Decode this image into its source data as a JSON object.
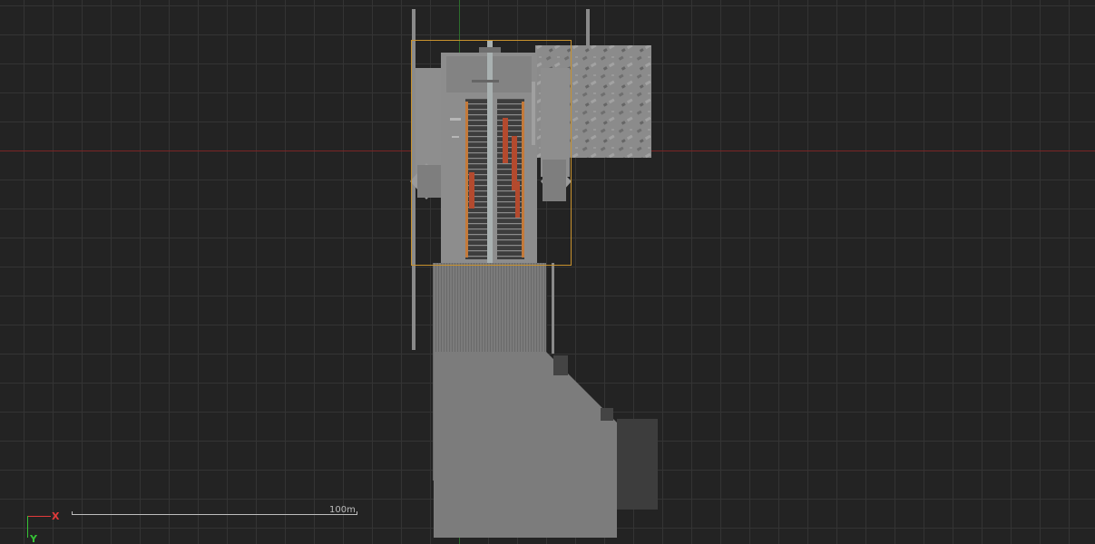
{
  "viewport": {
    "view": "top",
    "grid": true,
    "background_color": "#232323",
    "grid_color": "#343434"
  },
  "axes": {
    "x_label": "X",
    "y_label": "Y",
    "x_color": "#e23a3a",
    "y_color": "#36c236"
  },
  "scale_bar": {
    "label": "100m"
  },
  "selection": {
    "color": "#c8922e"
  }
}
